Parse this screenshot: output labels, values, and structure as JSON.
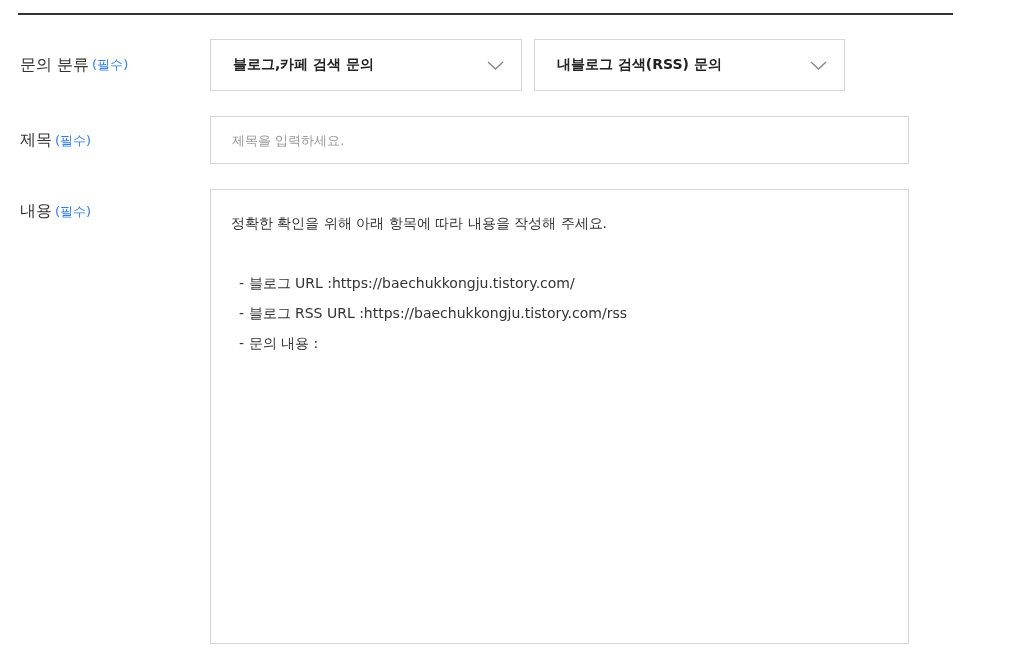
{
  "category": {
    "label": "문의 분류",
    "required": "(필수)",
    "selects": [
      {
        "value": "블로그,카페 검색 문의"
      },
      {
        "value": "내블로그 검색(RSS) 문의"
      }
    ]
  },
  "title": {
    "label": "제목",
    "required": "(필수)",
    "placeholder": "제목을 입력하세요."
  },
  "content": {
    "label": "내용",
    "required": "(필수)",
    "intro": "정확한 확인을 위해 아래 항목에 따라 내용을 작성해 주세요.",
    "items": [
      "- 블로그 URL :https://baechukkongju.tistory.com/",
      "- 블로그 RSS URL :https://baechukkongju.tistory.com/rss",
      "- 문의 내용 :"
    ]
  }
}
